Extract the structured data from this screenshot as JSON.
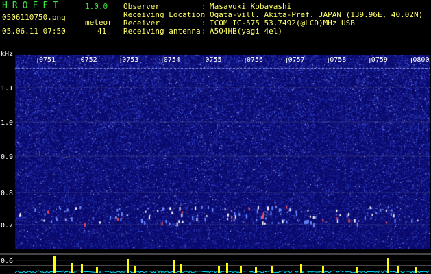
{
  "header": {
    "app_title": "HROFFT",
    "version": "1.0.0",
    "filename": "0506110750.png",
    "meteor_label": "meteor",
    "datetime": "05.06.11 07:50",
    "meteor_count": "41"
  },
  "info": [
    {
      "key": "Observer",
      "value": "Masayuki Kobayashi"
    },
    {
      "key": "Receiving Location",
      "value": "Ogata-vill. Akita-Pref. JAPAN (139.96E, 40.02N)"
    },
    {
      "key": "Receiver",
      "value": "ICOM IC-575 53.7492(@LCD)MHz USB"
    },
    {
      "key": "Receiving antenna",
      "value": "A504HB(yagi 4el)"
    }
  ],
  "spectrogram": {
    "unit_label": "kHz",
    "time_ticks": [
      "0751",
      "0752",
      "0753",
      "0754",
      "0755",
      "0756",
      "0757",
      "0758",
      "0759",
      "0800"
    ],
    "freq_ticks": [
      "1.1",
      "1.0",
      "0.9",
      "0.8",
      "0.7",
      "0.6"
    ],
    "colors": {
      "background": "#0a0a6e",
      "noise": "#4a60ff",
      "grid": "#8a8a8a",
      "meteor": "#ff5050",
      "signal_bar": "#ffff00",
      "baseline": "#00e0ff"
    }
  }
}
